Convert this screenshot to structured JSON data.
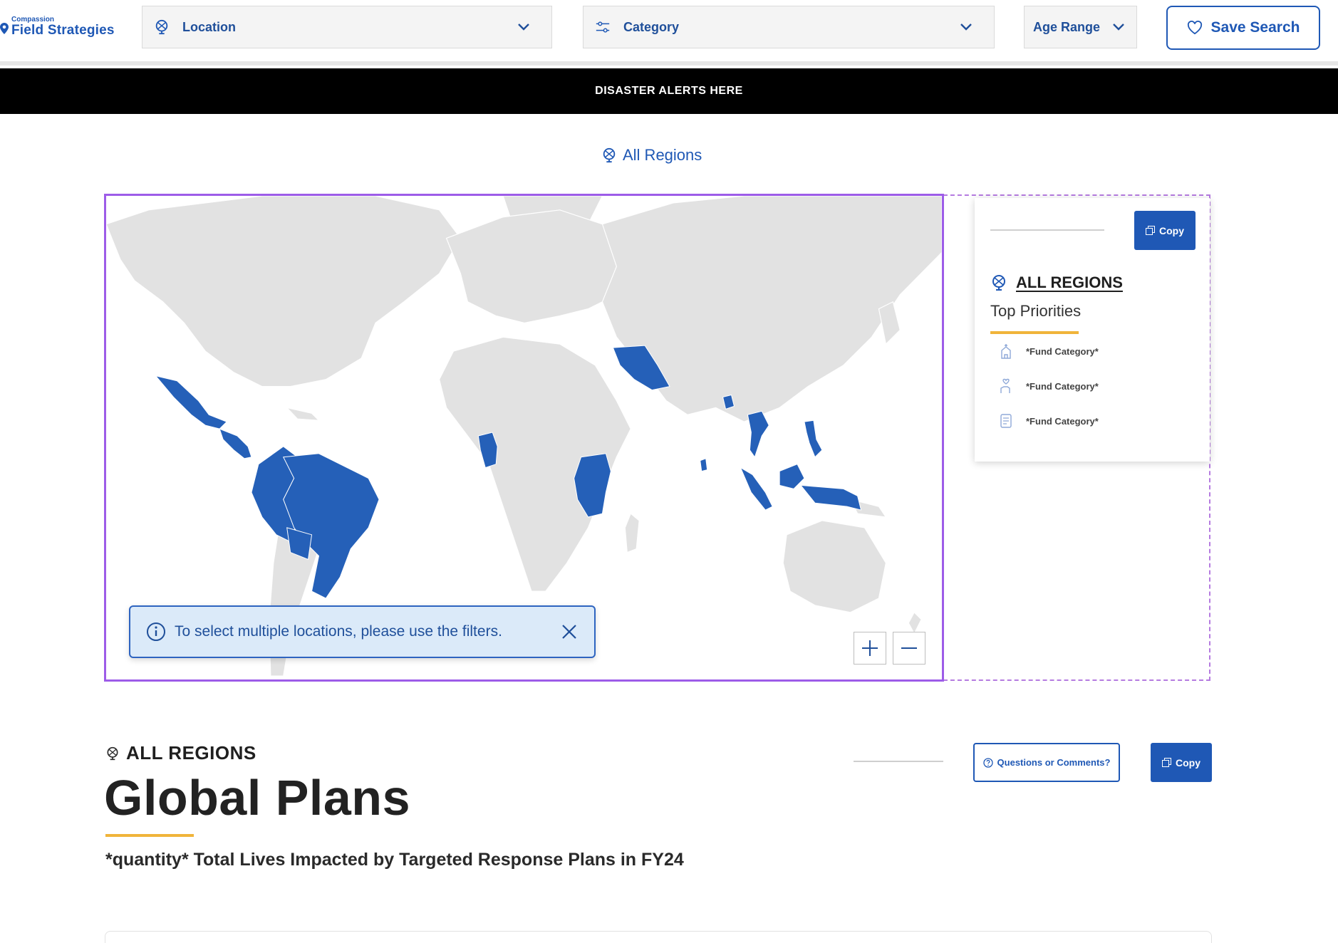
{
  "brand": {
    "small": "Compassion",
    "name": "Field Strategies"
  },
  "filters": {
    "location": "Location",
    "category": "Category",
    "age_range": "Age Range"
  },
  "save_search": "Save Search",
  "alert_banner": "DISASTER ALERTS HERE",
  "regions_link": "All Regions",
  "map": {
    "tip": "To select multiple locations, please use the filters.",
    "highlighted_countries": [
      "Mexico",
      "Guatemala",
      "Honduras",
      "El Salvador",
      "Nicaragua",
      "Haiti",
      "Dominican Republic",
      "Colombia",
      "Ecuador",
      "Peru",
      "Bolivia",
      "Brazil",
      "Togo",
      "Ghana",
      "Burkina Faso",
      "Kenya",
      "Tanzania",
      "Uganda",
      "Rwanda",
      "Ethiopia",
      "Iran",
      "Bangladesh",
      "Sri Lanka",
      "Thailand",
      "Indonesia",
      "Philippines"
    ],
    "highlight_color": "#2560b8",
    "land_color": "#e2e2e2"
  },
  "side_card": {
    "copy": "Copy",
    "region": "ALL REGIONS",
    "subtitle": "Top Priorities",
    "funds": [
      "*Fund Category*",
      "*Fund Category*",
      "*Fund Category*"
    ]
  },
  "global_plans": {
    "region": "ALL REGIONS",
    "title": "Global Plans",
    "subtitle": "*quantity* Total Lives Impacted by Targeted Response Plans in FY24",
    "questions": "Questions or Comments?",
    "copy": "Copy"
  },
  "colors": {
    "brand_blue": "#1f58b5",
    "accent_gold": "#f0b43a"
  }
}
